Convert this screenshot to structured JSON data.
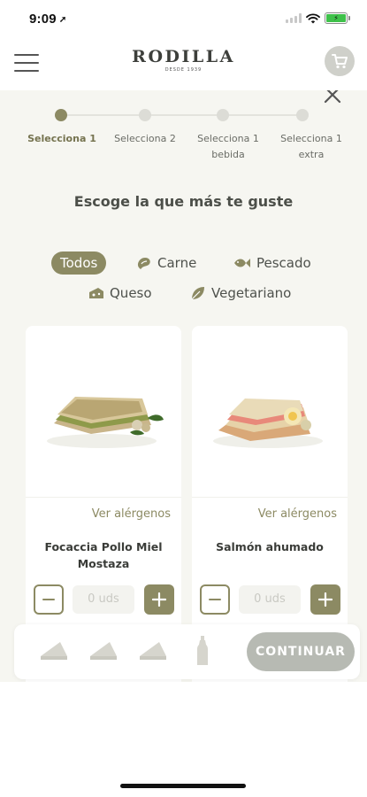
{
  "status_bar": {
    "time": "9:09",
    "location_glyph": "➚"
  },
  "header": {
    "brand": "RODILLA",
    "brand_tagline": "DESDE 1939"
  },
  "stepper": {
    "steps": [
      {
        "label": "Selecciona 1",
        "active": true
      },
      {
        "label": "Selecciona 2",
        "active": false
      },
      {
        "label": "Selecciona 1 bebida",
        "active": false
      },
      {
        "label": "Selecciona 1 extra",
        "active": false
      }
    ]
  },
  "main": {
    "title": "Escoge la que más te guste"
  },
  "filters": [
    {
      "label": "Todos",
      "icon": "none",
      "active": true
    },
    {
      "label": "Carne",
      "icon": "meat-icon",
      "active": false
    },
    {
      "label": "Pescado",
      "icon": "fish-icon",
      "active": false
    },
    {
      "label": "Queso",
      "icon": "cheese-icon",
      "active": false
    },
    {
      "label": "Vegetariano",
      "icon": "leaf-icon",
      "active": false
    }
  ],
  "products": [
    {
      "name": "Focaccia Pollo Miel Mostaza",
      "allergens_label": "Ver alérgenos",
      "quantity_text": "0 uds"
    },
    {
      "name": "Salmón ahumado",
      "allergens_label": "Ver alérgenos",
      "quantity_text": "0 uds"
    }
  ],
  "bottom_bar": {
    "slots": [
      "sandwich-icon",
      "sandwich-icon",
      "sandwich-icon",
      "bottle-icon"
    ],
    "continue_label": "CONTINUAR"
  },
  "colors": {
    "accent": "#8c8a63",
    "background": "#f6f6f1",
    "button_disabled": "#b7bab3"
  }
}
